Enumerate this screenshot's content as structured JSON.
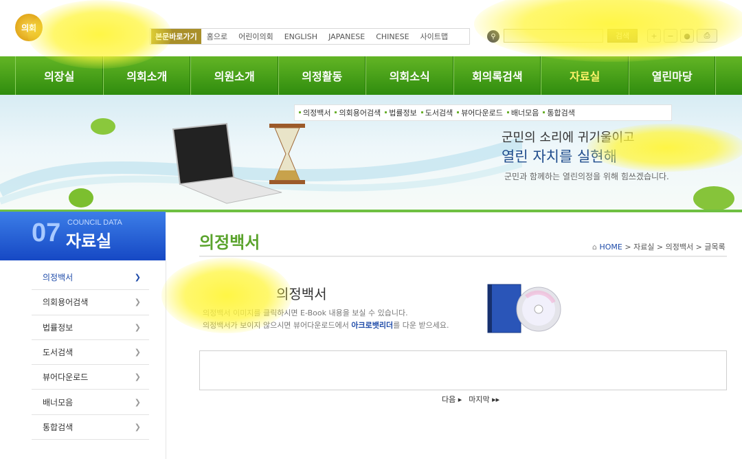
{
  "header": {
    "logo_text": "의회",
    "top_links": [
      "본문바로가기",
      "홈으로",
      "어린이의회",
      "ENGLISH",
      "JAPANESE",
      "CHINESE",
      "사이트맵"
    ],
    "search": {
      "placeholder": "",
      "button": "검색"
    },
    "tools": [
      "zoom-in-icon",
      "zoom-out-icon",
      "reset-icon",
      "print-icon"
    ]
  },
  "gnb": {
    "items": [
      "의장실",
      "의회소개",
      "의원소개",
      "의정활동",
      "의회소식",
      "회의록검색",
      "자료실",
      "열린마당"
    ],
    "active_index": 6,
    "active_color": "#fff36a"
  },
  "banner": {
    "subnav": [
      "의정백서",
      "의회용어검색",
      "법률정보",
      "도서검색",
      "뷰어다운로드",
      "배너모음",
      "통합검색"
    ],
    "slogan_line1": "군민의 소리에 귀기울이고",
    "slogan_line2": "열린 자치를 실현해",
    "slogan_line3": "군민과 함께하는 열린의정을 위해 힘쓰겠습니다."
  },
  "sidebar": {
    "number": "07",
    "english": "COUNCIL DATA",
    "title": "자료실",
    "items": [
      "의정백서",
      "의회용어검색",
      "법률정보",
      "도서검색",
      "뷰어다운로드",
      "배너모음",
      "통합검색"
    ],
    "active_index": 0
  },
  "content": {
    "page_title": "의정백서",
    "breadcrumb": {
      "home": "HOME",
      "rest": " > 자료실 > 의정백서 > 글목록"
    },
    "book_title": "의정백서",
    "desc_line1": "의정백서 이미지를 클릭하시면 E-Book 내용을 보실 수 있습니다.",
    "desc_line2_a": "의정백서가 보이지 않으시면 뷰어다운로드에서 ",
    "desc_line2_link": "아크로뱃리더",
    "desc_line2_b": "를 다운 받으세요.",
    "pager_next": "다음 ▸",
    "pager_last": "마지막 ▸▸"
  },
  "colors": {
    "brand_green": "#3f9a17",
    "side_blue": "#1d4aa8",
    "accent_gold": "#a98f2a"
  }
}
